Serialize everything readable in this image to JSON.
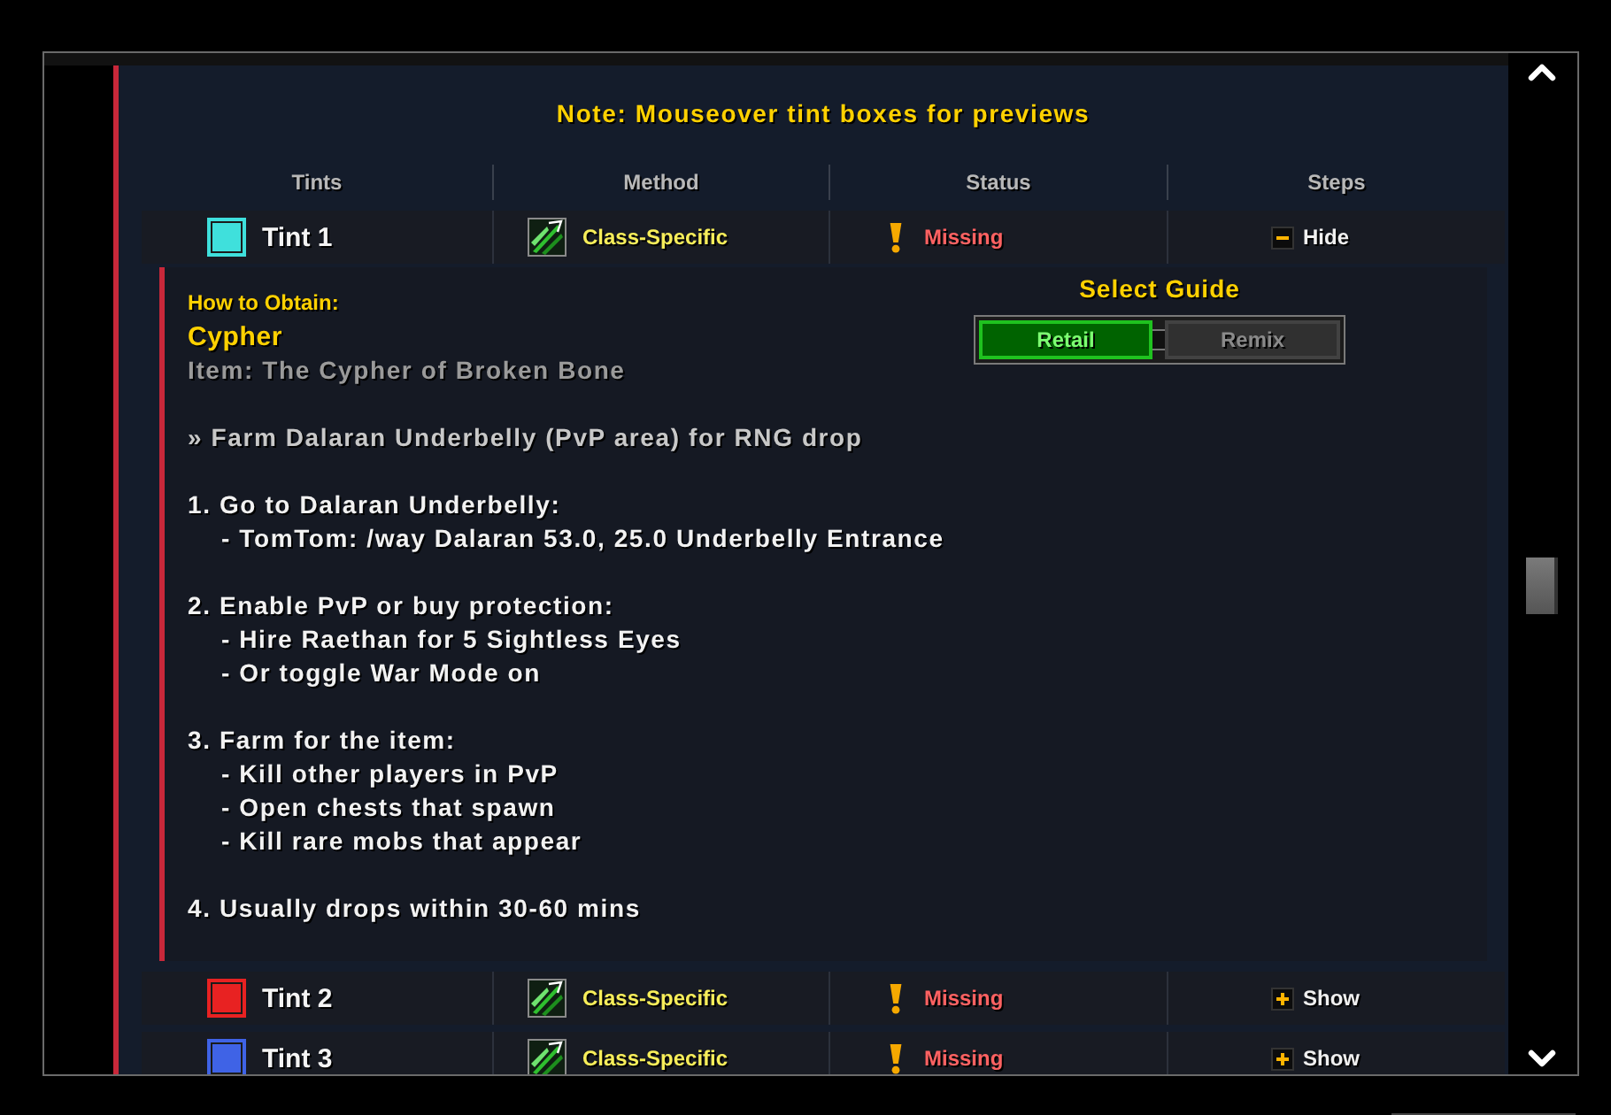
{
  "note": "Note: Mouseover tint boxes for previews",
  "columns": [
    "Tints",
    "Method",
    "Status",
    "Steps"
  ],
  "tints": [
    {
      "name": "Tint 1",
      "color": "#3fe0dc",
      "method": "Class-Specific",
      "status": "Missing",
      "steps_label": "Hide",
      "expanded": true,
      "details": {
        "heading": "How to Obtain:",
        "title": "Cypher",
        "item": "Item: The Cypher of Broken Bone",
        "summary": "» Farm Dalaran Underbelly (PvP area) for RNG drop",
        "steps": [
          {
            "text": "1. Go to Dalaran Underbelly:",
            "children": [
              {
                "text": "- TomTom: /way Dalaran 53.0, 25.0 Underbelly Entrance"
              }
            ]
          },
          {
            "text": "2. Enable PvP or buy protection:",
            "children": [
              {
                "text": "- Hire Raethan for 5 Sightless Eyes"
              },
              {
                "text": "- Or toggle War Mode on"
              }
            ]
          },
          {
            "text": "3. Farm for the item:",
            "children": [
              {
                "text": "- Kill other players in PvP"
              },
              {
                "text": "- Open chests that spawn"
              },
              {
                "text": "- Kill rare mobs that appear"
              }
            ]
          },
          {
            "text": "4. Usually drops within 30-60 mins"
          }
        ],
        "guide": {
          "title": "Select Guide",
          "options": [
            {
              "label": "Retail",
              "selected": true
            },
            {
              "label": "Remix",
              "selected": false
            }
          ]
        }
      }
    },
    {
      "name": "Tint 2",
      "color": "#e82222",
      "method": "Class-Specific",
      "status": "Missing",
      "steps_label": "Show",
      "expanded": false
    },
    {
      "name": "Tint 3",
      "color": "#3f63e6",
      "method": "Class-Specific",
      "status": "Missing",
      "steps_label": "Show",
      "expanded": false
    }
  ]
}
